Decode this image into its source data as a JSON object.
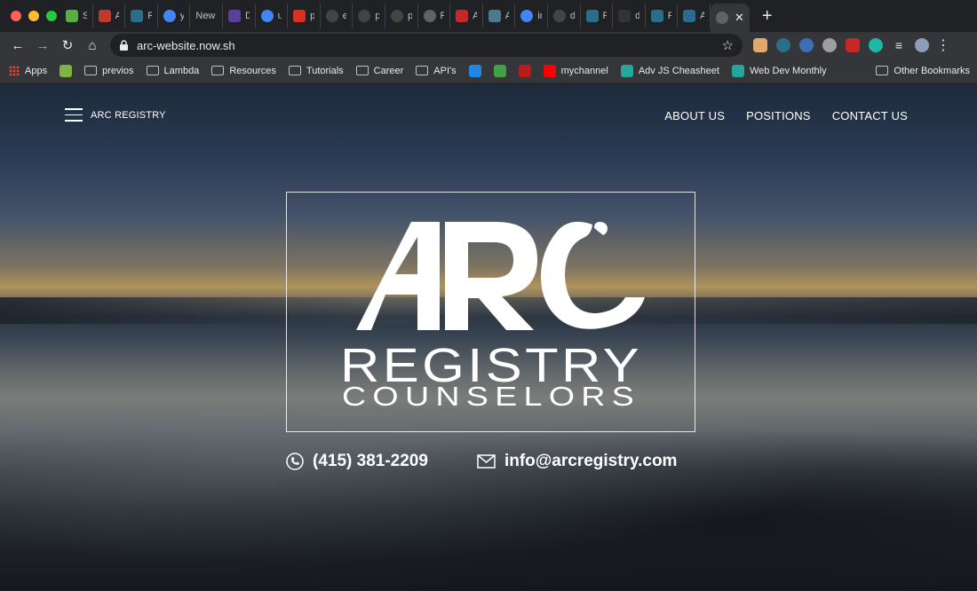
{
  "browser": {
    "tabs": [
      {
        "label": "Sc",
        "icon": "trello-icon",
        "color": "#5aac44"
      },
      {
        "label": "Ad",
        "icon": "signature-icon",
        "color": "#c0392b"
      },
      {
        "label": "Re",
        "icon": "react-icon",
        "color": "#2a6f89"
      },
      {
        "label": "ya",
        "icon": "google-icon",
        "color": "#4285f4"
      },
      {
        "label": "New T",
        "icon": "",
        "color": ""
      },
      {
        "label": "De",
        "icon": "doc-icon",
        "color": "#5b3fa0"
      },
      {
        "label": "un",
        "icon": "google-icon",
        "color": "#4285f4"
      },
      {
        "label": "pu",
        "icon": "pdf-icon",
        "color": "#d93025"
      },
      {
        "label": "ex",
        "icon": "github-icon",
        "color": "#444"
      },
      {
        "label": "pu",
        "icon": "github-icon",
        "color": "#444"
      },
      {
        "label": "pu",
        "icon": "github-icon",
        "color": "#444"
      },
      {
        "label": "Pu",
        "icon": "globe-icon",
        "color": "#5f6368"
      },
      {
        "label": "A",
        "icon": "star-badge-icon",
        "color": "#c62828"
      },
      {
        "label": "All",
        "icon": "bookmark-icon",
        "color": "#4a7a8c"
      },
      {
        "label": "im",
        "icon": "google-icon",
        "color": "#4285f4"
      },
      {
        "label": "de",
        "icon": "github-icon",
        "color": "#444"
      },
      {
        "label": "Re",
        "icon": "react-icon",
        "color": "#2a6f89"
      },
      {
        "label": "de",
        "icon": "triangle-icon",
        "color": "#333"
      },
      {
        "label": "Re",
        "icon": "react-icon",
        "color": "#2a6f89"
      },
      {
        "label": "As",
        "icon": "box-icon",
        "color": "#2d6a8f"
      }
    ],
    "url": "arc-website.now.sh",
    "bookmarks": [
      {
        "label": "Apps",
        "kind": "apps"
      },
      {
        "label": "",
        "kind": "square",
        "color": "#7cb342"
      },
      {
        "label": "previos",
        "kind": "folder"
      },
      {
        "label": "Lambda",
        "kind": "folder"
      },
      {
        "label": "Resources",
        "kind": "folder"
      },
      {
        "label": "Tutorials",
        "kind": "folder"
      },
      {
        "label": "Career",
        "kind": "folder"
      },
      {
        "label": "API's",
        "kind": "folder"
      },
      {
        "label": "",
        "kind": "square",
        "color": "#1e88e5"
      },
      {
        "label": "",
        "kind": "square",
        "color": "#43a047"
      },
      {
        "label": "",
        "kind": "square",
        "color": "#b71c1c"
      },
      {
        "label": "mychannel",
        "kind": "square",
        "color": "#ff0000"
      },
      {
        "label": "Adv JS Cheasheet",
        "kind": "square",
        "color": "#26a69a"
      },
      {
        "label": "Web Dev Monthly",
        "kind": "square",
        "color": "#26a69a"
      }
    ],
    "other_bookmarks": "Other Bookmarks"
  },
  "site": {
    "brand": "ARC REGISTRY",
    "nav": [
      "ABOUT US",
      "POSITIONS",
      "CONTACT US"
    ],
    "logo": {
      "main": "ARC",
      "line1": "REGISTRY",
      "line2": "COUNSELORS"
    },
    "phone": "(415) 381-2209",
    "email": "info@arcregistry.com"
  }
}
